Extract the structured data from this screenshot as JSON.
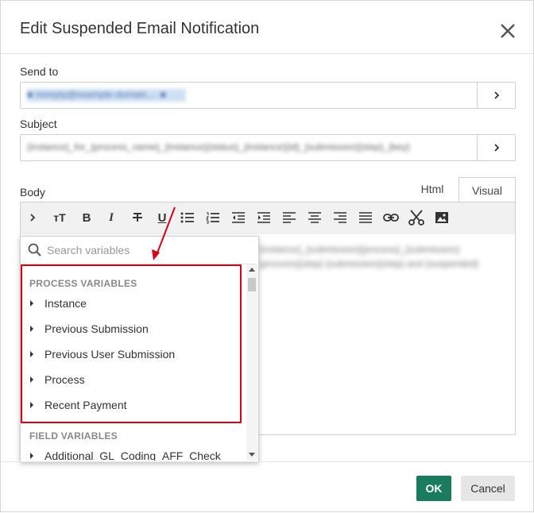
{
  "dialog": {
    "title": "Edit Suspended Email Notification"
  },
  "send_to": {
    "label": "Send to",
    "value": "■ noreply@example-domain.... ■"
  },
  "subject": {
    "label": "Subject",
    "value": "{instance}_for_{process_name}_{instance}{status}_{instance}{id}_{submission}{step}_{key}"
  },
  "body": {
    "label": "Body",
    "tabs": [
      {
        "label": "Html"
      },
      {
        "label": "Visual",
        "active": true
      }
    ],
    "content": "{instance}_{submission}{process}_{submission}{process}{step} {submission}{step} and {suspended}"
  },
  "toolbar": {
    "icons": [
      "chevron-right-icon",
      "text-size-icon",
      "bold-icon",
      "italic-icon",
      "strikethrough-icon",
      "underline-icon",
      "bullet-list-icon",
      "numbered-list-icon",
      "outdent-icon",
      "indent-icon",
      "align-left-icon",
      "align-center-icon",
      "align-right-icon",
      "align-justify-icon",
      "link-icon",
      "cut-icon",
      "image-icon"
    ],
    "bold_glyph": "B",
    "italic_glyph": "I",
    "text_size_glyph": "тT",
    "underline_glyph": "U"
  },
  "variables": {
    "search_placeholder": "Search variables",
    "process_section": "PROCESS VARIABLES",
    "process_items": [
      {
        "label": "Instance"
      },
      {
        "label": "Previous Submission"
      },
      {
        "label": "Previous User Submission"
      },
      {
        "label": "Process"
      },
      {
        "label": "Recent Payment"
      }
    ],
    "field_section": "FIELD VARIABLES",
    "field_items": [
      {
        "label": "Additional_GL_Coding_AFF_Check"
      }
    ]
  },
  "footer": {
    "ok_label": "OK",
    "cancel_label": "Cancel"
  },
  "colors": {
    "ok": "#1a7c5c",
    "highlight": "#d0021b",
    "cancel": "#e6e6e6"
  }
}
